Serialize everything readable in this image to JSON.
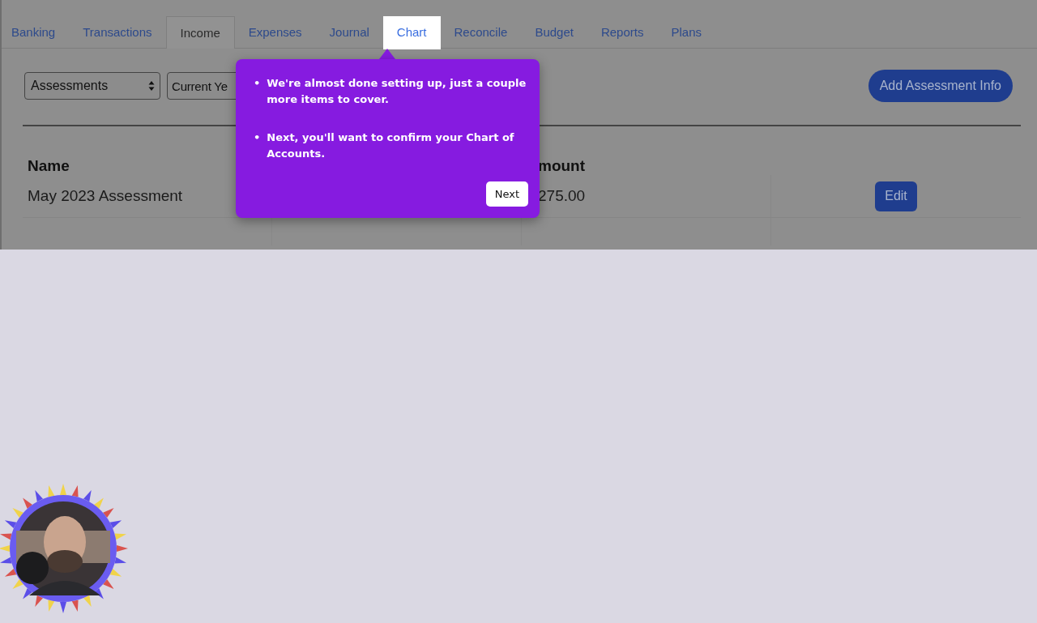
{
  "tabs": [
    {
      "label": "Banking",
      "selected": false,
      "highlighted": false
    },
    {
      "label": "Transactions",
      "selected": false,
      "highlighted": false
    },
    {
      "label": "Income",
      "selected": true,
      "highlighted": false
    },
    {
      "label": "Expenses",
      "selected": false,
      "highlighted": false
    },
    {
      "label": "Journal",
      "selected": false,
      "highlighted": false
    },
    {
      "label": "Chart",
      "selected": false,
      "highlighted": true
    },
    {
      "label": "Reconcile",
      "selected": false,
      "highlighted": false
    },
    {
      "label": "Budget",
      "selected": false,
      "highlighted": false
    },
    {
      "label": "Reports",
      "selected": false,
      "highlighted": false
    },
    {
      "label": "Plans",
      "selected": false,
      "highlighted": false
    }
  ],
  "filters": [
    {
      "value": "Assessments"
    },
    {
      "value": "Current Ye"
    }
  ],
  "add_button": "Add Assessment Info",
  "table": {
    "columns": [
      {
        "label": "Name",
        "kind": "name"
      },
      {
        "label": "mount",
        "kind": "amount"
      }
    ],
    "rows": [
      {
        "name": "May 2023 Assessment",
        "amount": "275.00",
        "action": "Edit"
      }
    ]
  },
  "tour_popover": {
    "marker": "•",
    "items": [
      "We're almost done setting up, just a couple more items to cover.",
      "Next, you'll want to confirm your Chart of Accounts."
    ],
    "button": "Next"
  }
}
